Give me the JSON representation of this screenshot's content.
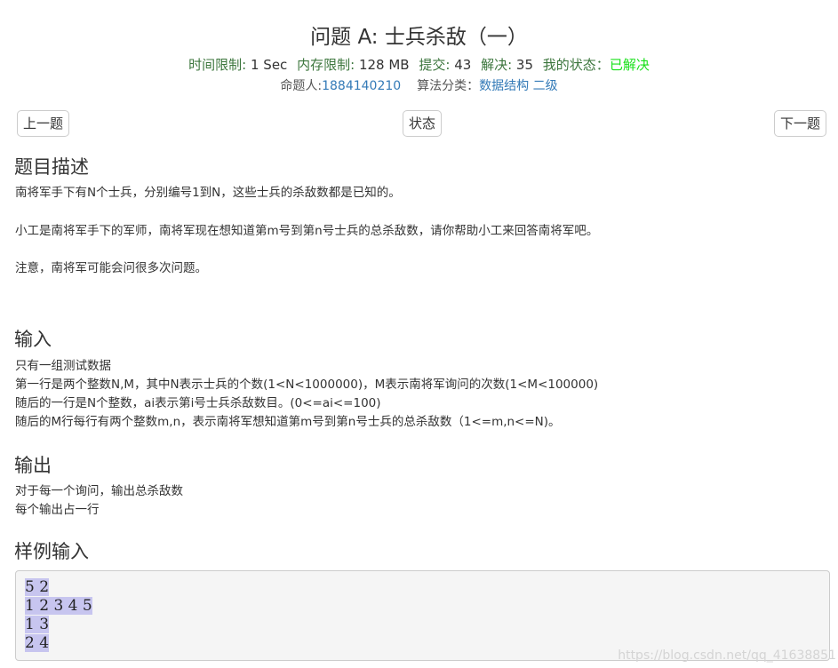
{
  "problem": {
    "title": "问题 A: 士兵杀敌（一）",
    "time_limit_label": "时间限制:",
    "time_limit": "1 Sec",
    "memory_limit_label": "内存限制:",
    "memory_limit": "128 MB",
    "submit_label": "提交:",
    "submit": "43",
    "solved_label": "解决:",
    "solved": "35",
    "my_status_label": "我的状态：",
    "my_status": "已解决",
    "author_label": "命题人:",
    "author": "1884140210",
    "category_label": "算法分类：",
    "category_tags": [
      "数据结构",
      "二级"
    ]
  },
  "nav": {
    "prev": "上一题",
    "status": "状态",
    "next": "下一题"
  },
  "sections": {
    "description_heading": "题目描述",
    "description": [
      "南将军手下有N个士兵，分别编号1到N，这些士兵的杀敌数都是已知的。",
      "小工是南将军手下的军师，南将军现在想知道第m号到第n号士兵的总杀敌数，请你帮助小工来回答南将军吧。",
      "注意，南将军可能会问很多次问题。"
    ],
    "input_heading": "输入",
    "input": [
      "只有一组测试数据",
      "第一行是两个整数N,M，其中N表示士兵的个数(1<N<1000000)，M表示南将军询问的次数(1<M<100000)",
      "随后的一行是N个整数，ai表示第i号士兵杀敌数目。(0<=ai<=100)",
      "随后的M行每行有两个整数m,n，表示南将军想知道第m号到第n号士兵的总杀敌数（1<=m,n<=N)。"
    ],
    "output_heading": "输出",
    "output": [
      "对于每一个询问，输出总杀敌数",
      "每个输出占一行"
    ],
    "sample_input_heading": "样例输入",
    "sample_input": [
      "5 2",
      "1 2 3 4 5",
      "1 3",
      "2 4"
    ]
  },
  "watermark": "https://blog.csdn.net/qq_41638851"
}
